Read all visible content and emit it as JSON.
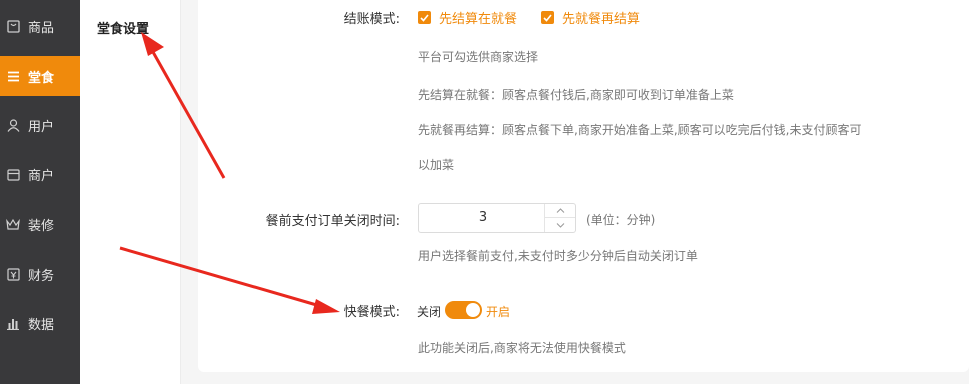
{
  "nav": [
    {
      "label": "商品",
      "icon": "goods-icon",
      "active": false
    },
    {
      "label": "堂食",
      "icon": "menu-icon",
      "active": true
    },
    {
      "label": "用户",
      "icon": "user-icon",
      "active": false
    },
    {
      "label": "商户",
      "icon": "store-icon",
      "active": false
    },
    {
      "label": "装修",
      "icon": "crown-icon",
      "active": false
    },
    {
      "label": "财务",
      "icon": "finance-icon",
      "active": false
    },
    {
      "label": "数据",
      "icon": "chart-icon",
      "active": false
    }
  ],
  "subnav": {
    "title": "堂食设置"
  },
  "form": {
    "checkout": {
      "label": "结账模式:",
      "option1": "先结算在就餐",
      "option2": "先就餐再结算",
      "hint1": "平台可勾选供商家选择",
      "hint2": "先结算在就餐：顾客点餐付钱后,商家即可收到订单准备上菜",
      "hint3": "先就餐再结算：顾客点餐下单,商家开始准备上菜,顾客可以吃完后付钱,未支付顾客可",
      "hint4": "以加菜"
    },
    "close_time": {
      "label": "餐前支付订单关闭时间:",
      "value": "3",
      "unit": "(单位：分钟)",
      "hint": "用户选择餐前支付,未支付时多少分钟后自动关闭订单"
    },
    "fast_mode": {
      "label": "快餐模式:",
      "off_label": "关闭",
      "on_label": "开启",
      "enabled": true,
      "hint": "此功能关闭后,商家将无法使用快餐模式"
    }
  },
  "colors": {
    "accent": "#f08a0c",
    "sidebar": "#39393b",
    "annotation_arrow": "#e8281e"
  }
}
